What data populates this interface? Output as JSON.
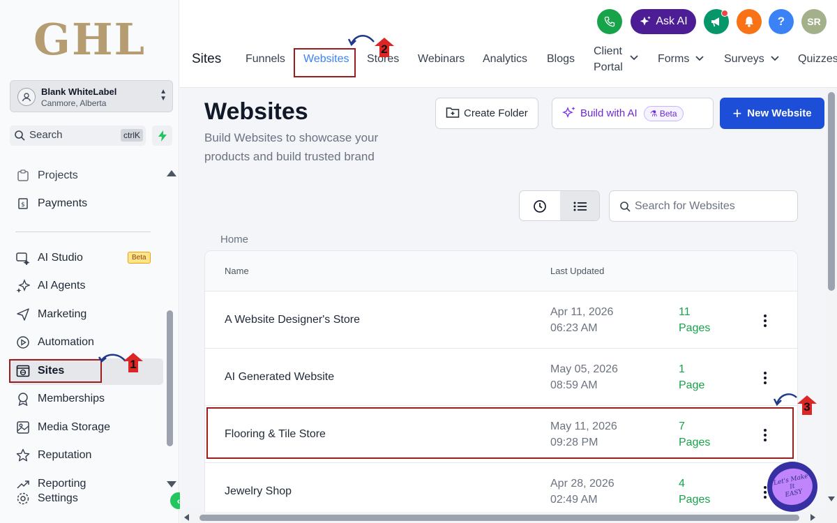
{
  "brand": {
    "logo_text": "GHL",
    "logo_color": "#b69d71"
  },
  "account": {
    "name": "Blank WhiteLabel",
    "location": "Canmore, Alberta"
  },
  "sidebar": {
    "search_label": "Search",
    "search_shortcut": "ctrlK",
    "items": [
      {
        "label": "Projects",
        "icon": "clipboard-icon"
      },
      {
        "label": "Payments",
        "icon": "payment-icon"
      },
      {
        "label": "AI Studio",
        "icon": "ai-studio-icon",
        "badge": "Beta"
      },
      {
        "label": "AI Agents",
        "icon": "sparkle-icon"
      },
      {
        "label": "Marketing",
        "icon": "send-icon"
      },
      {
        "label": "Automation",
        "icon": "play-icon"
      },
      {
        "label": "Sites",
        "icon": "globe-window-icon",
        "active": true
      },
      {
        "label": "Memberships",
        "icon": "award-icon"
      },
      {
        "label": "Media Storage",
        "icon": "image-icon"
      },
      {
        "label": "Reputation",
        "icon": "star-icon"
      },
      {
        "label": "Reporting",
        "icon": "trend-icon"
      },
      {
        "label": "Settings",
        "icon": "gear-icon"
      }
    ]
  },
  "topbar": {
    "ask_ai_label": "Ask AI",
    "help_label": "?",
    "avatar_initials": "SR",
    "colors": {
      "phone": "#16a34a",
      "ask_ai": "#4c1d95",
      "announce": "#059669",
      "notify": "#f97316",
      "help": "#3b82f6",
      "avatar": "#a3b18a"
    },
    "page_label": "Sites",
    "tabs": [
      {
        "label": "Funnels"
      },
      {
        "label": "Websites",
        "active": true
      },
      {
        "label": "Stores"
      },
      {
        "label": "Webinars"
      },
      {
        "label": "Analytics"
      },
      {
        "label": "Blogs"
      },
      {
        "label_line1": "Client",
        "label_line2": "Portal",
        "has_dropdown": true
      },
      {
        "label": "Forms",
        "has_dropdown": true
      },
      {
        "label": "Surveys",
        "has_dropdown": true
      },
      {
        "label": "Quizzes"
      }
    ]
  },
  "main": {
    "title": "Websites",
    "subtitle": "Build Websites to showcase your products and build trusted brand",
    "create_folder_label": "Create Folder",
    "build_ai_label": "Build with AI",
    "build_ai_badge": "Beta",
    "new_website_label": "New Website",
    "search_placeholder": "Search for Websites",
    "breadcrumb": "Home",
    "table": {
      "columns": [
        "Name",
        "Last Updated"
      ],
      "rows": [
        {
          "name": "A Website Designer's Store",
          "date": "Apr 11, 2026",
          "time": "06:23 AM",
          "pages_count": "11",
          "pages_label": "Pages"
        },
        {
          "name": "AI Generated Website",
          "date": "May 05, 2026",
          "time": "08:59 AM",
          "pages_count": "1",
          "pages_label": "Page"
        },
        {
          "name": "Flooring & Tile Store",
          "date": "May 11, 2026",
          "time": "09:28 PM",
          "pages_count": "7",
          "pages_label": "Pages"
        },
        {
          "name": "Jewelry Shop",
          "date": "Apr 28, 2026",
          "time": "02:49 AM",
          "pages_count": "4",
          "pages_label": "Pages"
        }
      ]
    }
  },
  "annotations": {
    "markers": [
      "1",
      "2",
      "3"
    ],
    "color": "#9b1c1c"
  },
  "watermark": {
    "line1": "Let's Make",
    "line2": "It",
    "line3": "EASY"
  }
}
